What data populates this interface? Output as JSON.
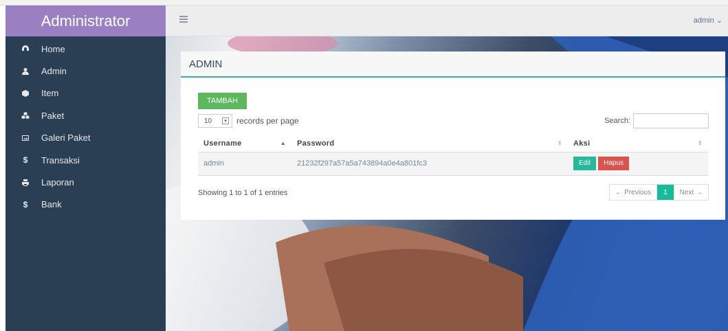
{
  "sidebar": {
    "brand": "Administrator",
    "items": [
      {
        "label": "Home",
        "icon": "dashboard-icon"
      },
      {
        "label": "Admin",
        "icon": "user-icon"
      },
      {
        "label": "Item",
        "icon": "cube-icon"
      },
      {
        "label": "Paket",
        "icon": "cubes-icon"
      },
      {
        "label": "Galeri Paket",
        "icon": "image-icon"
      },
      {
        "label": "Transaksi",
        "icon": "dollar-icon",
        "glyph": "$"
      },
      {
        "label": "Laporan",
        "icon": "print-icon"
      },
      {
        "label": "Bank",
        "icon": "dollar-icon",
        "glyph": "$"
      }
    ]
  },
  "topnav": {
    "user_label": "admin ⌄"
  },
  "panel": {
    "title": "ADMIN",
    "add_button": "TAMBAH",
    "length_value": "10",
    "length_suffix": "records per page",
    "search_label": "Search:",
    "search_value": "",
    "columns": [
      "Username",
      "Password",
      "Aksi"
    ],
    "rows": [
      {
        "username": "admin",
        "password": "21232f297a57a5a743894a0e4a801fc3",
        "edit": "Edit",
        "delete": "Hapus"
      }
    ],
    "info": "Showing 1 to 1 of 1 entries",
    "pager": {
      "prev": "← Previous",
      "current": "1",
      "next": "Next →"
    }
  },
  "colors": {
    "sidebar_bg": "#2a3f54",
    "brand_bg": "#9a7fc2",
    "add_button": "#5cb85c",
    "edit_button": "#26b99a",
    "delete_button": "#d9534f",
    "pager_active": "#1abb9c"
  }
}
